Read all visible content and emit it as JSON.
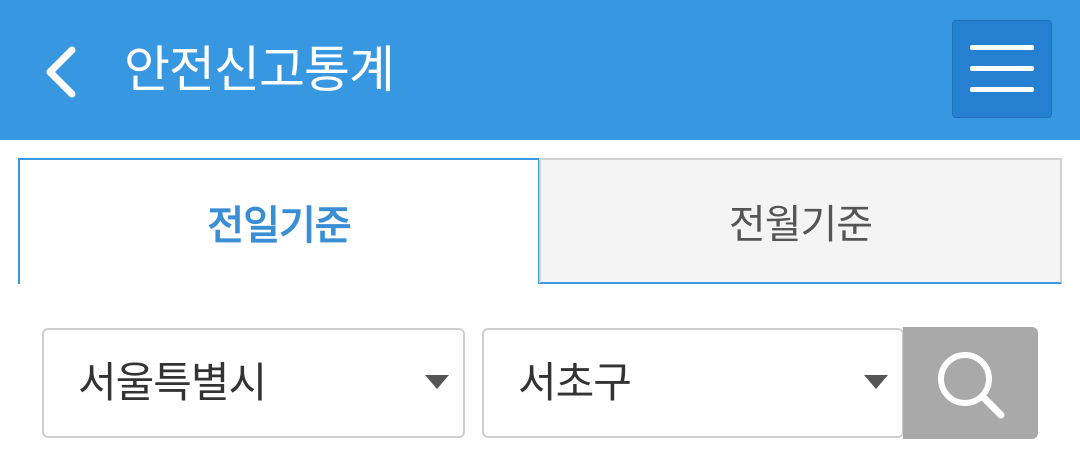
{
  "header": {
    "title": "안전신고통계",
    "back_icon": "chevron-left-icon",
    "menu_icon": "hamburger-menu-icon",
    "background_color": "#3797e0"
  },
  "tabs": [
    {
      "label": "전일기준",
      "active": true
    },
    {
      "label": "전월기준",
      "active": false
    }
  ],
  "filters": {
    "city": {
      "selected": "서울특별시"
    },
    "district": {
      "selected": "서초구"
    },
    "search_icon": "search-icon"
  },
  "colors": {
    "accent": "#3797e0",
    "menu_button": "#2580d2",
    "active_tab_text": "#3a8fd4",
    "search_button": "#a9a9a9"
  }
}
